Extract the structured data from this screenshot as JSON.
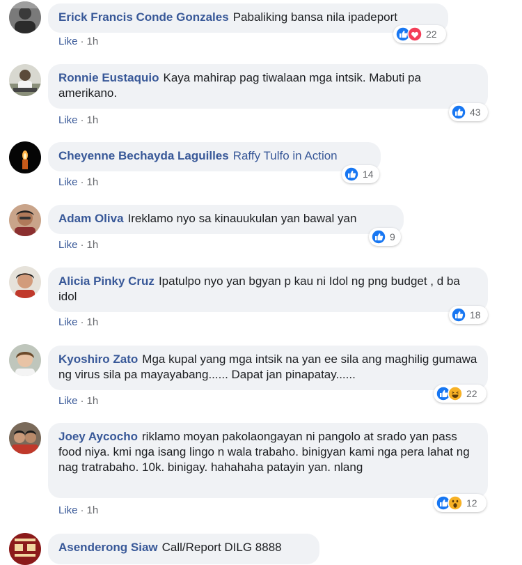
{
  "comments": [
    {
      "author": "Erick Francis Conde Gonzales",
      "text": "Pabaliking bansa nila ipadeport",
      "reactions": [
        "like",
        "love"
      ],
      "count": "22",
      "like": "Like",
      "time": "1h"
    },
    {
      "author": "Ronnie Eustaquio",
      "text": "Kaya mahirap pag tiwalaan mga intsik. Mabuti pa amerikano.",
      "reactions": [
        "like"
      ],
      "count": "43",
      "like": "Like",
      "time": "1h"
    },
    {
      "author": "Cheyenne Bechayda Laguilles",
      "text": "Raffy Tulfo in Action",
      "reactions": [
        "like"
      ],
      "count": "14",
      "like": "Like",
      "time": "1h"
    },
    {
      "author": "Adam Oliva",
      "text": "Ireklamo nyo sa kinauukulan yan bawal yan",
      "reactions": [
        "like"
      ],
      "count": "9",
      "like": "Like",
      "time": "1h"
    },
    {
      "author": "Alicia Pinky Cruz",
      "text": "Ipatulpo nyo yan bgyan p kau ni Idol ng png budget , d ba idol",
      "reactions": [
        "like"
      ],
      "count": "18",
      "like": "Like",
      "time": "1h"
    },
    {
      "author": "Kyoshiro Zato",
      "text": "Mga kupal yang mga intsik na yan ee sila ang maghilig gumawa ng virus sila pa mayayabang...... Dapat jan pinapatay......",
      "reactions": [
        "like",
        "haha"
      ],
      "count": "22",
      "like": "Like",
      "time": "1h"
    },
    {
      "author": "Joey Aycocho",
      "text": "riklamo moyan pakolaongayan ni pangolo at srado yan pass food niya. kmi nga isang lingo n wala trabaho. binigyan kami nga pera lahat ng nag tratrabaho. 10k. binigay. hahahaha patayin yan. nlang",
      "reactions": [
        "like",
        "wow"
      ],
      "count": "12",
      "like": "Like",
      "time": "1h"
    },
    {
      "author": "Asenderong Siaw",
      "text": "Call/Report DILG 8888"
    }
  ],
  "colors": {
    "author": "#385898",
    "bubble": "#f0f2f5",
    "meta": "#65676b",
    "like_blue": "#1877f2",
    "love_red": "#f33e58",
    "haha_yellow": "#f7b125"
  }
}
